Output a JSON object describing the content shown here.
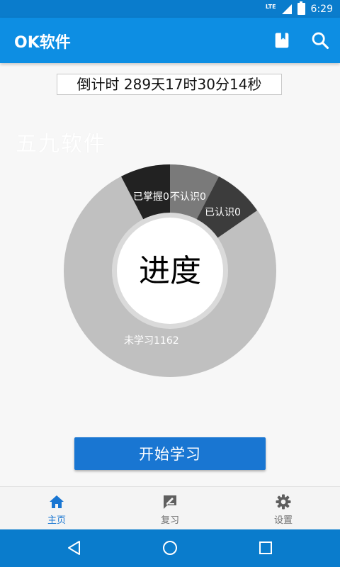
{
  "status_bar": {
    "network": "LTE",
    "time": "6:29"
  },
  "app_bar": {
    "title": "OK软件",
    "actions": [
      "book-icon",
      "search-icon"
    ]
  },
  "countdown": {
    "text": "倒计时  289天17时30分14秒"
  },
  "watermark": "五九软件",
  "chart_data": {
    "type": "pie",
    "variant": "donut",
    "center_label": "进度",
    "slices": [
      {
        "label": "已掌握0",
        "value": 0,
        "color": "#222222"
      },
      {
        "label": "不认识0",
        "value": 0,
        "color": "#7a7a7a"
      },
      {
        "label": "已认识0",
        "value": 0,
        "color": "#3c3c3c"
      },
      {
        "label": "未学习1162",
        "value": 1162,
        "color": "#c0c0c0"
      }
    ]
  },
  "start_button": {
    "label": "开始学习"
  },
  "bottom_nav": [
    {
      "label": "主页",
      "icon": "home-icon",
      "active": true
    },
    {
      "label": "复习",
      "icon": "review-icon",
      "active": false
    },
    {
      "label": "设置",
      "icon": "gear-icon",
      "active": false
    }
  ],
  "system_nav": [
    "back-icon",
    "home-circle-icon",
    "recents-icon"
  ]
}
